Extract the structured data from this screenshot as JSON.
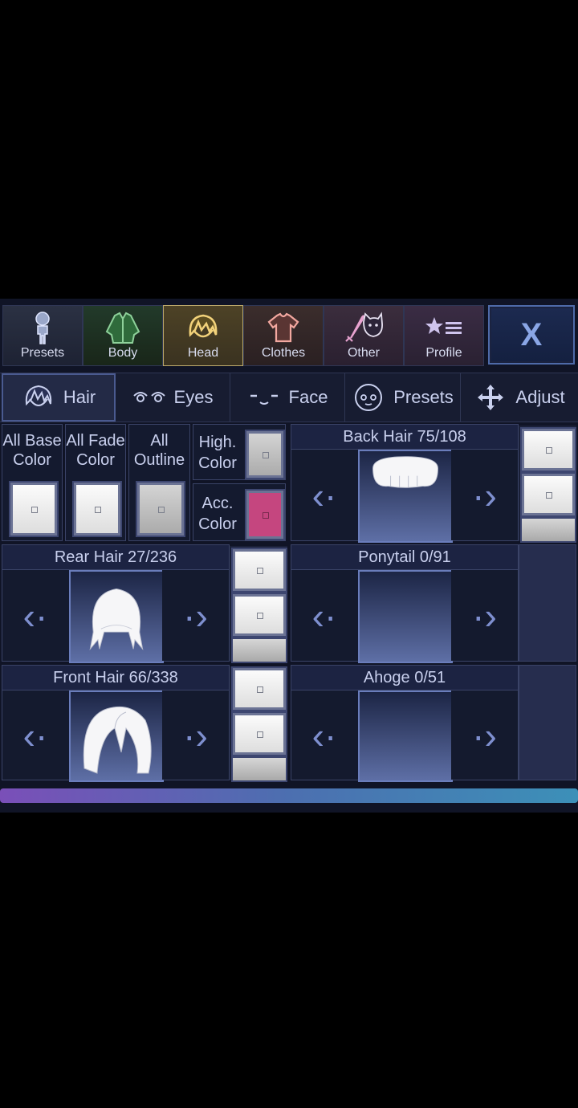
{
  "top_tabs": [
    {
      "label": "Presets",
      "icon": "character-icon"
    },
    {
      "label": "Body",
      "icon": "jacket-icon"
    },
    {
      "label": "Head",
      "icon": "hair-head-icon"
    },
    {
      "label": "Clothes",
      "icon": "shirt-icon"
    },
    {
      "label": "Other",
      "icon": "sword-cat-icon"
    },
    {
      "label": "Profile",
      "icon": "star-list-icon"
    }
  ],
  "close_label": "X",
  "sub_tabs": [
    {
      "label": "Hair",
      "icon": "hair-icon"
    },
    {
      "label": "Eyes",
      "icon": "eyes-icon"
    },
    {
      "label": "Face",
      "icon": "face-icon"
    },
    {
      "label": "Presets",
      "icon": "face-preset-icon"
    },
    {
      "label": "Adjust",
      "icon": "move-arrows-icon"
    }
  ],
  "color_options": [
    {
      "label_line1": "All Base",
      "label_line2": "Color",
      "color": "#f5f5f5"
    },
    {
      "label_line1": "All Fade",
      "label_line2": "Color",
      "color": "#f0f0f0"
    },
    {
      "label_line1": "All",
      "label_line2": "Outline",
      "color": "#c4c4c4"
    },
    {
      "label_line1": "High.",
      "label_line2": "Color",
      "color": "#c9c9c9"
    },
    {
      "label_line1": "Acc.",
      "label_line2": "Color",
      "color": "#c5467f"
    }
  ],
  "parts": {
    "back_hair": "Back Hair 75/108",
    "rear_hair": "Rear Hair 27/236",
    "front_hair": "Front Hair 66/338",
    "ponytail": "Ponytail 0/91",
    "ahoge": "Ahoge 0/51"
  },
  "arrow_left": "‹·",
  "arrow_right": "·›"
}
